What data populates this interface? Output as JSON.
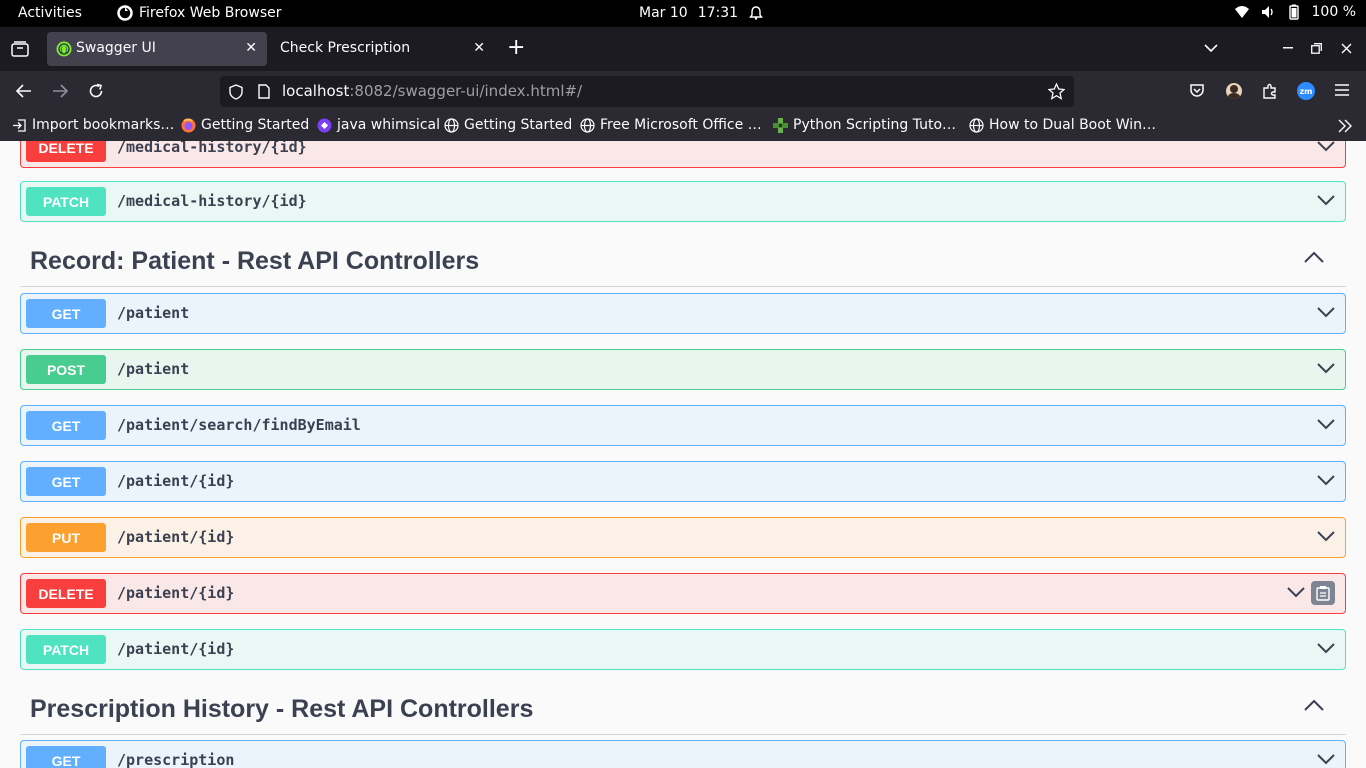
{
  "system_bar": {
    "activities": "Activities",
    "app_name": "Firefox Web Browser",
    "date": "Mar 10",
    "time": "17:31",
    "battery": "100 %"
  },
  "tabs": [
    {
      "label": "Swagger UI",
      "active": true
    },
    {
      "label": "Check Prescription",
      "active": false
    }
  ],
  "url": {
    "host": "localhost",
    "rest": ":8082/swagger-ui/index.html#/"
  },
  "bookmarks": [
    {
      "label": "Import bookmarks…",
      "icon": "import-icon"
    },
    {
      "label": "Getting Started",
      "icon": "firefox-icon"
    },
    {
      "label": "java whimsical",
      "icon": "whimsical-icon"
    },
    {
      "label": "Getting Started",
      "icon": "globe-icon"
    },
    {
      "label": "Free Microsoft Office …",
      "icon": "globe-icon"
    },
    {
      "label": "Python Scripting Tuto…",
      "icon": "python-icon"
    },
    {
      "label": "How to Dual Boot Win…",
      "icon": "globe-icon"
    }
  ],
  "partial_top": {
    "method": "DELETE",
    "path": "/medical-history/{id}"
  },
  "operations_top": [
    {
      "method": "PATCH",
      "path": "/medical-history/{id}"
    }
  ],
  "sections": [
    {
      "title": "Record: Patient - Rest API Controllers",
      "operations": [
        {
          "method": "GET",
          "path": "/patient"
        },
        {
          "method": "POST",
          "path": "/patient"
        },
        {
          "method": "GET",
          "path": "/patient/search/findByEmail"
        },
        {
          "method": "GET",
          "path": "/patient/{id}"
        },
        {
          "method": "PUT",
          "path": "/patient/{id}"
        },
        {
          "method": "DELETE",
          "path": "/patient/{id}"
        },
        {
          "method": "PATCH",
          "path": "/patient/{id}"
        }
      ]
    },
    {
      "title": "Prescription History - Rest API Controllers",
      "operations": [
        {
          "method": "GET",
          "path": "/prescription"
        }
      ]
    }
  ],
  "colors": {
    "get": "#61affe",
    "post": "#49cc90",
    "put": "#fca130",
    "delete": "#f93e3e",
    "patch": "#50e3c2"
  }
}
